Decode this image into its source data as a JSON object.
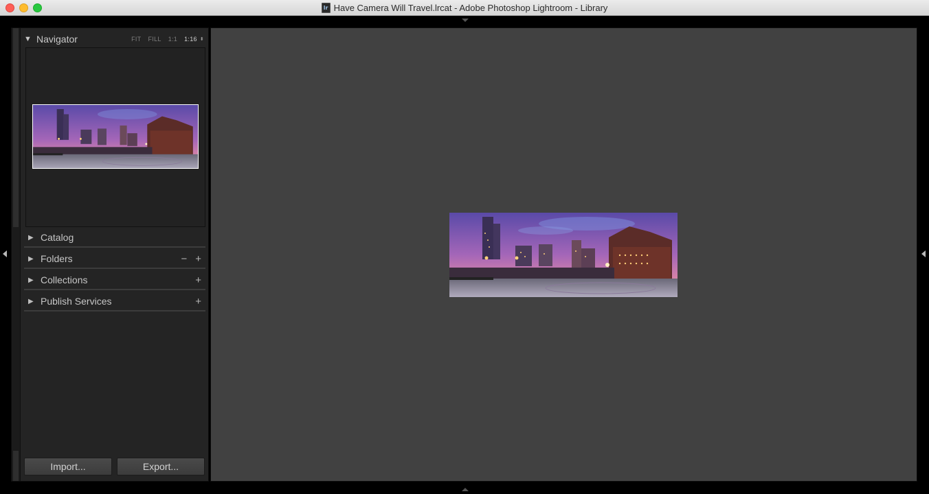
{
  "window": {
    "title": "Have Camera Will Travel.lrcat - Adobe Photoshop Lightroom - Library",
    "doc_icon_glyph": "lr"
  },
  "navigator": {
    "title": "Navigator",
    "zoom_options": [
      "FIT",
      "FILL",
      "1:1",
      "1:16"
    ],
    "active_zoom": "1:16"
  },
  "sections": [
    {
      "label": "Catalog"
    },
    {
      "label": "Folders"
    },
    {
      "label": "Collections"
    },
    {
      "label": "Publish Services"
    }
  ],
  "buttons": {
    "import": "Import...",
    "export": "Export..."
  },
  "colors": {
    "workspace_bg": "#414141",
    "panel_bg": "#242424",
    "photo_sky": "#7a5fb0"
  },
  "icons": {
    "collapse": "triangle-down-icon",
    "expand": "triangle-right-icon",
    "minus": "minus-icon",
    "plus": "plus-icon"
  }
}
